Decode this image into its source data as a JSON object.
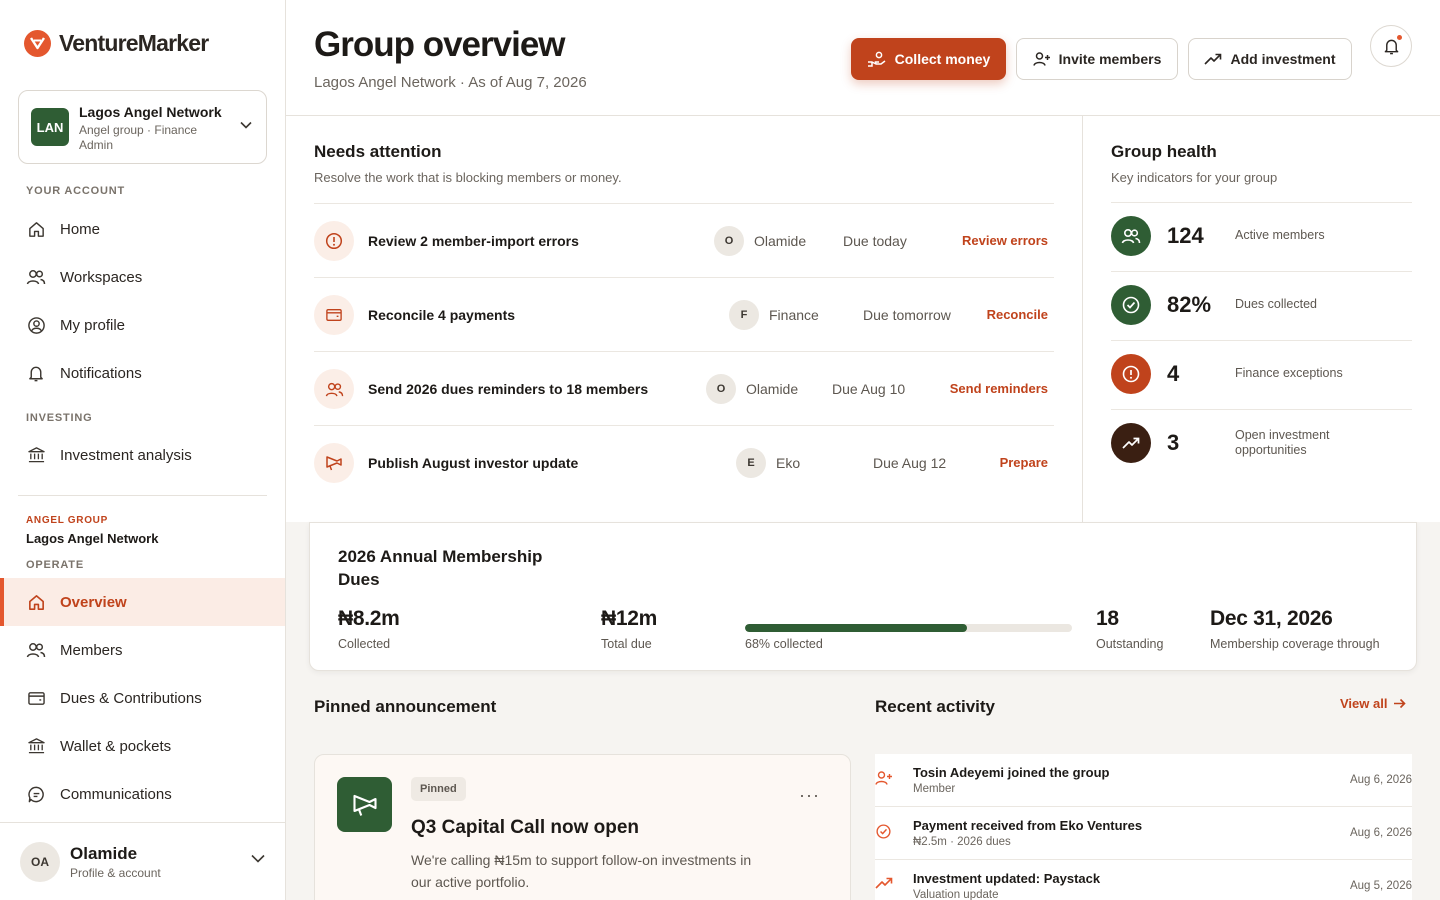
{
  "brand": {
    "name": "VentureMarker",
    "accent": "#e4572e",
    "accent_dark": "#c0431c",
    "green": "#2f5d34"
  },
  "org": {
    "initials": "LAN",
    "name": "Lagos Angel Network",
    "role": "Angel group · Finance Admin"
  },
  "sidebar": {
    "your_account_label": "YOUR ACCOUNT",
    "account_items": [
      {
        "label": "Home",
        "icon": "home-icon"
      },
      {
        "label": "Workspaces",
        "icon": "people-icon"
      },
      {
        "label": "My profile",
        "icon": "user-circle-icon"
      },
      {
        "label": "Notifications",
        "icon": "bell-icon"
      }
    ],
    "investing_label": "INVESTING",
    "investing_items": [
      {
        "label": "Investment analysis",
        "icon": "bank-icon"
      }
    ],
    "angel_group_label": "ANGEL GROUP",
    "angel_group_name": "Lagos Angel Network",
    "operate_label": "OPERATE",
    "operate_items": [
      {
        "label": "Overview",
        "icon": "home-icon",
        "active": true
      },
      {
        "label": "Members",
        "icon": "people-icon"
      },
      {
        "label": "Dues & Contributions",
        "icon": "wallet-icon"
      },
      {
        "label": "Wallet & pockets",
        "icon": "bank-icon"
      },
      {
        "label": "Communications",
        "icon": "chat-icon"
      }
    ]
  },
  "user": {
    "initials": "OA",
    "name": "Olamide",
    "sub": "Profile & account"
  },
  "header": {
    "title": "Group overview",
    "subtitle": "Lagos Angel Network · As of Aug 7, 2026",
    "collect_label": "Collect money",
    "invite_label": "Invite members",
    "add_investment_label": "Add investment"
  },
  "attention": {
    "title": "Needs attention",
    "subtitle": "Resolve the work that is blocking members or money.",
    "tasks": [
      {
        "title": "Review 2 member-import errors",
        "owner_initial": "O",
        "owner": "Olamide",
        "due": "Due today",
        "action": "Review errors",
        "icon": "alert-icon"
      },
      {
        "title": "Reconcile 4 payments",
        "owner_initial": "F",
        "owner": "Finance",
        "due": "Due tomorrow",
        "action": "Reconcile",
        "icon": "wallet-icon"
      },
      {
        "title": "Send 2026 dues reminders to 18 members",
        "owner_initial": "O",
        "owner": "Olamide",
        "due": "Due Aug 10",
        "action": "Send reminders",
        "icon": "people-icon"
      },
      {
        "title": "Publish August investor update",
        "owner_initial": "E",
        "owner": "Eko",
        "due": "Due Aug 12",
        "action": "Prepare",
        "icon": "megaphone-icon"
      }
    ]
  },
  "health": {
    "title": "Group health",
    "subtitle": "Key indicators for your group",
    "metrics": [
      {
        "value": "124",
        "label": "Active members",
        "color": "#2f5d34",
        "icon": "people-icon"
      },
      {
        "value": "82%",
        "label": "Dues collected",
        "color": "#2f5d34",
        "icon": "check-circle-icon"
      },
      {
        "value": "4",
        "label": "Finance exceptions",
        "color": "#c0431c",
        "icon": "alert-icon"
      },
      {
        "value": "3",
        "label": "Open investment opportunities",
        "color": "#3a1f12",
        "icon": "trend-up-icon"
      }
    ]
  },
  "dues": {
    "title": "2026 Annual Membership Dues",
    "collected_value": "₦8.2m",
    "collected_label": "Collected",
    "total_value": "₦12m",
    "total_label": "Total due",
    "progress_fraction": 0.68,
    "progress_label": "68% collected",
    "outstanding_value": "18",
    "outstanding_label": "Outstanding",
    "coverage_value": "Dec 31, 2026",
    "coverage_label": "Membership coverage through"
  },
  "announcement": {
    "section_title": "Pinned announcement",
    "pill": "Pinned",
    "title": "Q3 Capital Call now open",
    "body": "We're calling ₦15m to support follow-on investments in our active portfolio.",
    "more": "···"
  },
  "activity": {
    "section_title": "Recent activity",
    "view_all": "View all",
    "items": [
      {
        "title": "Tosin Adeyemi joined the group",
        "sub": "Member",
        "date": "Aug 6, 2026",
        "icon": "user-plus-icon"
      },
      {
        "title": "Payment received from Eko Ventures",
        "sub": "₦2.5m · 2026 dues",
        "date": "Aug 6, 2026",
        "icon": "check-circle-icon"
      },
      {
        "title": "Investment updated: Paystack",
        "sub": "Valuation update",
        "date": "Aug 5, 2026",
        "icon": "trend-up-icon"
      }
    ]
  }
}
